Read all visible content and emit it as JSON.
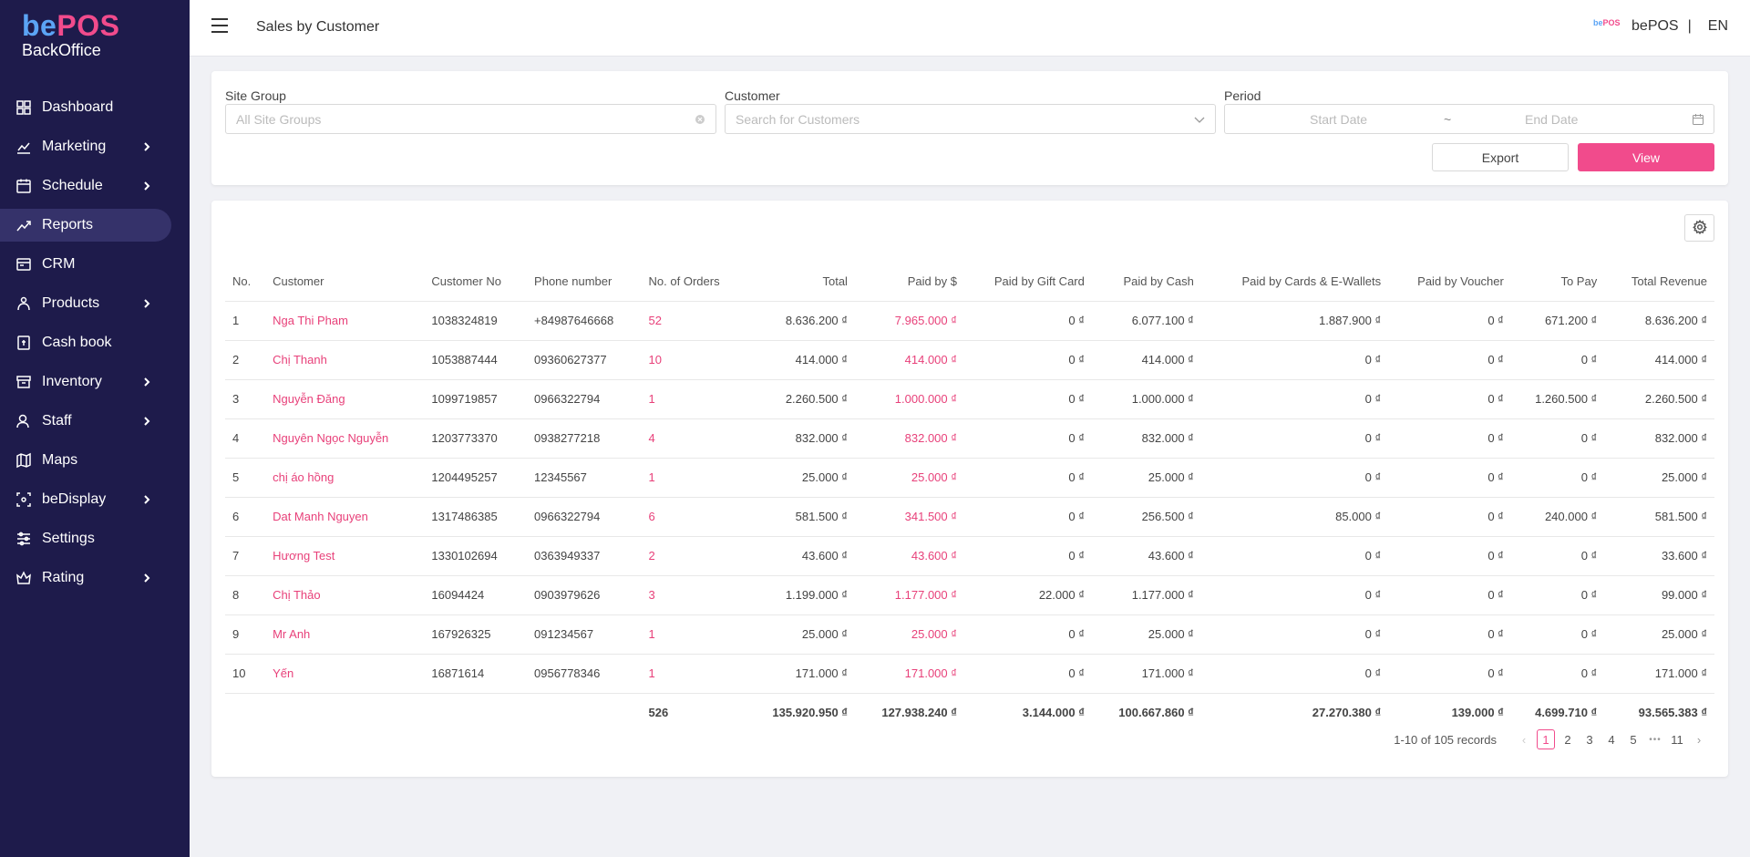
{
  "brand": {
    "be": "be",
    "pos": "POS",
    "sub": "BackOffice",
    "mini_be": "be",
    "mini_pos": "POS"
  },
  "sidebar": {
    "items": [
      {
        "label": "Dashboard",
        "icon": "dashboard-icon",
        "has_children": false,
        "active": false
      },
      {
        "label": "Marketing",
        "icon": "marketing-icon",
        "has_children": true,
        "active": false
      },
      {
        "label": "Schedule",
        "icon": "calendar-icon",
        "has_children": true,
        "active": false
      },
      {
        "label": "Reports",
        "icon": "chart-icon",
        "has_children": false,
        "active": true
      },
      {
        "label": "CRM",
        "icon": "crm-icon",
        "has_children": false,
        "active": false
      },
      {
        "label": "Products",
        "icon": "products-icon",
        "has_children": true,
        "active": false
      },
      {
        "label": "Cash book",
        "icon": "cashbook-icon",
        "has_children": false,
        "active": false
      },
      {
        "label": "Inventory",
        "icon": "inventory-icon",
        "has_children": true,
        "active": false
      },
      {
        "label": "Staff",
        "icon": "staff-icon",
        "has_children": true,
        "active": false
      },
      {
        "label": "Maps",
        "icon": "map-icon",
        "has_children": false,
        "active": false
      },
      {
        "label": "beDisplay",
        "icon": "display-icon",
        "has_children": true,
        "active": false
      },
      {
        "label": "Settings",
        "icon": "settings-sliders-icon",
        "has_children": false,
        "active": false
      },
      {
        "label": "Rating",
        "icon": "rating-icon",
        "has_children": true,
        "active": true
      }
    ]
  },
  "header": {
    "title": "Sales by Customer",
    "account": "bePOS",
    "separator": "|",
    "language": "EN"
  },
  "filters": {
    "site_group_label": "Site Group",
    "site_group_placeholder": "All Site Groups",
    "customer_label": "Customer",
    "customer_placeholder": "Search for Customers",
    "period_label": "Period",
    "start_placeholder": "Start Date",
    "range_sep": "~",
    "end_placeholder": "End Date",
    "export_label": "Export",
    "view_label": "View"
  },
  "table": {
    "columns": [
      "No.",
      "Customer",
      "Customer No",
      "Phone number",
      "No. of Orders",
      "Total",
      "Paid by $",
      "Paid by Gift Card",
      "Paid by Cash",
      "Paid by Cards & E-Wallets",
      "Paid by Voucher",
      "To Pay",
      "Total Revenue"
    ],
    "rows": [
      [
        "1",
        "Nga Thi Pham",
        "1038324819",
        "+84987646668",
        "52",
        "8.636.200 ₫",
        "7.965.000 ₫",
        "0 ₫",
        "6.077.100 ₫",
        "1.887.900 ₫",
        "0 ₫",
        "671.200 ₫",
        "8.636.200 ₫"
      ],
      [
        "2",
        "Chị Thanh",
        "1053887444",
        "09360627377",
        "10",
        "414.000 ₫",
        "414.000 ₫",
        "0 ₫",
        "414.000 ₫",
        "0 ₫",
        "0 ₫",
        "0 ₫",
        "414.000 ₫"
      ],
      [
        "3",
        "Nguyễn Đăng",
        "1099719857",
        "0966322794",
        "1",
        "2.260.500 ₫",
        "1.000.000 ₫",
        "0 ₫",
        "1.000.000 ₫",
        "0 ₫",
        "0 ₫",
        "1.260.500 ₫",
        "2.260.500 ₫"
      ],
      [
        "4",
        "Nguyên Ngọc Nguyễn",
        "1203773370",
        "0938277218",
        "4",
        "832.000 ₫",
        "832.000 ₫",
        "0 ₫",
        "832.000 ₫",
        "0 ₫",
        "0 ₫",
        "0 ₫",
        "832.000 ₫"
      ],
      [
        "5",
        "chị áo hồng",
        "1204495257",
        "12345567",
        "1",
        "25.000 ₫",
        "25.000 ₫",
        "0 ₫",
        "25.000 ₫",
        "0 ₫",
        "0 ₫",
        "0 ₫",
        "25.000 ₫"
      ],
      [
        "6",
        "Dat Manh Nguyen",
        "1317486385",
        "0966322794",
        "6",
        "581.500 ₫",
        "341.500 ₫",
        "0 ₫",
        "256.500 ₫",
        "85.000 ₫",
        "0 ₫",
        "240.000 ₫",
        "581.500 ₫"
      ],
      [
        "7",
        "Hương Test",
        "1330102694",
        "0363949337",
        "2",
        "43.600 ₫",
        "43.600 ₫",
        "0 ₫",
        "43.600 ₫",
        "0 ₫",
        "0 ₫",
        "0 ₫",
        "33.600 ₫"
      ],
      [
        "8",
        "Chị Thảo",
        "16094424",
        "0903979626",
        "3",
        "1.199.000 ₫",
        "1.177.000 ₫",
        "22.000 ₫",
        "1.177.000 ₫",
        "0 ₫",
        "0 ₫",
        "0 ₫",
        "99.000 ₫"
      ],
      [
        "9",
        "Mr Anh",
        "167926325",
        "091234567",
        "1",
        "25.000 ₫",
        "25.000 ₫",
        "0 ₫",
        "25.000 ₫",
        "0 ₫",
        "0 ₫",
        "0 ₫",
        "25.000 ₫"
      ],
      [
        "10",
        "Yến",
        "16871614",
        "0956778346",
        "1",
        "171.000 ₫",
        "171.000 ₫",
        "0 ₫",
        "171.000 ₫",
        "0 ₫",
        "0 ₫",
        "0 ₫",
        "171.000 ₫"
      ]
    ],
    "totals": [
      "",
      "",
      "",
      "",
      "526",
      "135.920.950 ₫",
      "127.938.240 ₫",
      "3.144.000 ₫",
      "100.667.860 ₫",
      "27.270.380 ₫",
      "139.000 ₫",
      "4.699.710 ₫",
      "93.565.383 ₫"
    ]
  },
  "pagination": {
    "info": "1-10 of 105 records",
    "pages": [
      "1",
      "2",
      "3",
      "4",
      "5"
    ],
    "ellipsis": "•••",
    "last": "11",
    "current": "1",
    "prev": "‹",
    "next": "›"
  },
  "colors": {
    "sidebar_bg": "#1e1b4b",
    "accent": "#f14b8c",
    "link": "#e8417a"
  }
}
